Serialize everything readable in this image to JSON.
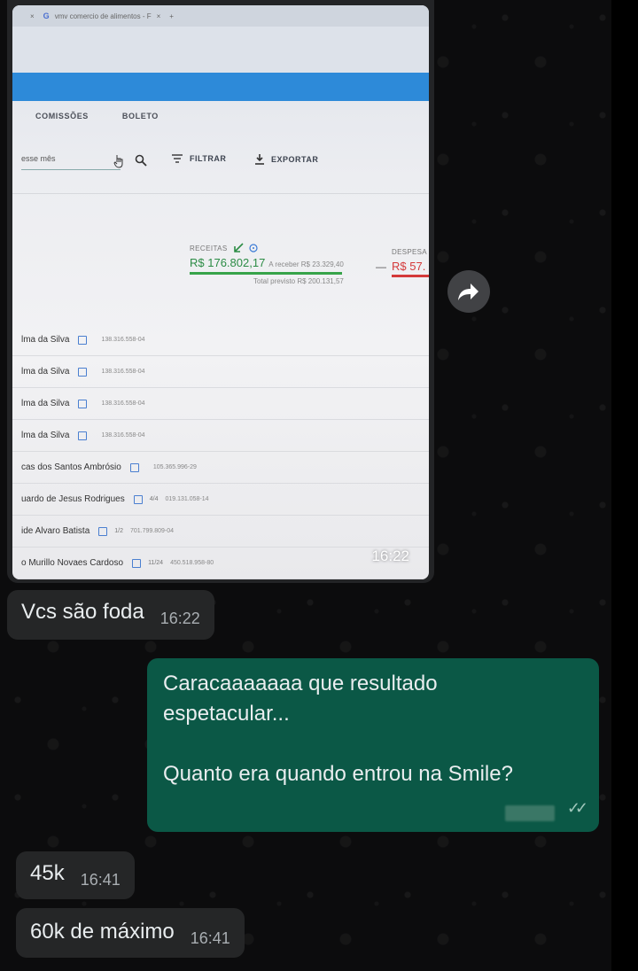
{
  "screenshot": {
    "browser": {
      "close_glyph": "×",
      "tab_title": "vmv comercio de alimentos - F",
      "tab_close": "×",
      "new_tab": "+"
    },
    "nav_tabs": [
      "COMISSÕES",
      "BOLETO"
    ],
    "search_value": "esse mês",
    "filter_label": "FILTRAR",
    "export_label": "EXPORTAR",
    "receitas": {
      "label": "RECEITAS",
      "value": "R$ 176.802,17",
      "receber": "A receber R$ 23.329,40",
      "total_previsto": "Total previsto R$ 200.131,57"
    },
    "dash": "—",
    "despesas": {
      "label": "DESPESA",
      "value": "R$ 57."
    },
    "rows": [
      {
        "name": "lma da Silva",
        "badge": "",
        "doc": "138.316.558-04"
      },
      {
        "name": "lma da Silva",
        "badge": "",
        "doc": "138.316.558-04"
      },
      {
        "name": "lma da Silva",
        "badge": "",
        "doc": "138.316.558-04"
      },
      {
        "name": "lma da Silva",
        "badge": "",
        "doc": "138.316.558-04"
      },
      {
        "name": "cas dos Santos Ambrósio",
        "badge": "",
        "doc": "105.365.996-29"
      },
      {
        "name": "uardo de Jesus Rodrigues",
        "badge": "4/4",
        "doc": "019.131.058-14"
      },
      {
        "name": "ide Alvaro Batista",
        "badge": "1/2",
        "doc": "701.799.809-04"
      },
      {
        "name": "o Murillo Novaes Cardoso",
        "badge": "11/24",
        "doc": "450.518.958-80"
      }
    ],
    "time": "16:22"
  },
  "messages": [
    {
      "type": "incoming",
      "text": "Vcs são foda",
      "time": "16:22"
    },
    {
      "type": "outgoing",
      "line1": "Caracaaaaaaa que resultado",
      "line2": "espetacular...",
      "line3": "Quanto era quando entrou na Smile?"
    },
    {
      "type": "incoming",
      "text": "45k",
      "time": "16:41"
    },
    {
      "type": "incoming",
      "text": "60k de máximo",
      "time": "16:41"
    }
  ],
  "colors": {
    "incoming_bubble": "#252627",
    "outgoing_bubble": "#0b5846",
    "background": "#0c0c0d"
  }
}
